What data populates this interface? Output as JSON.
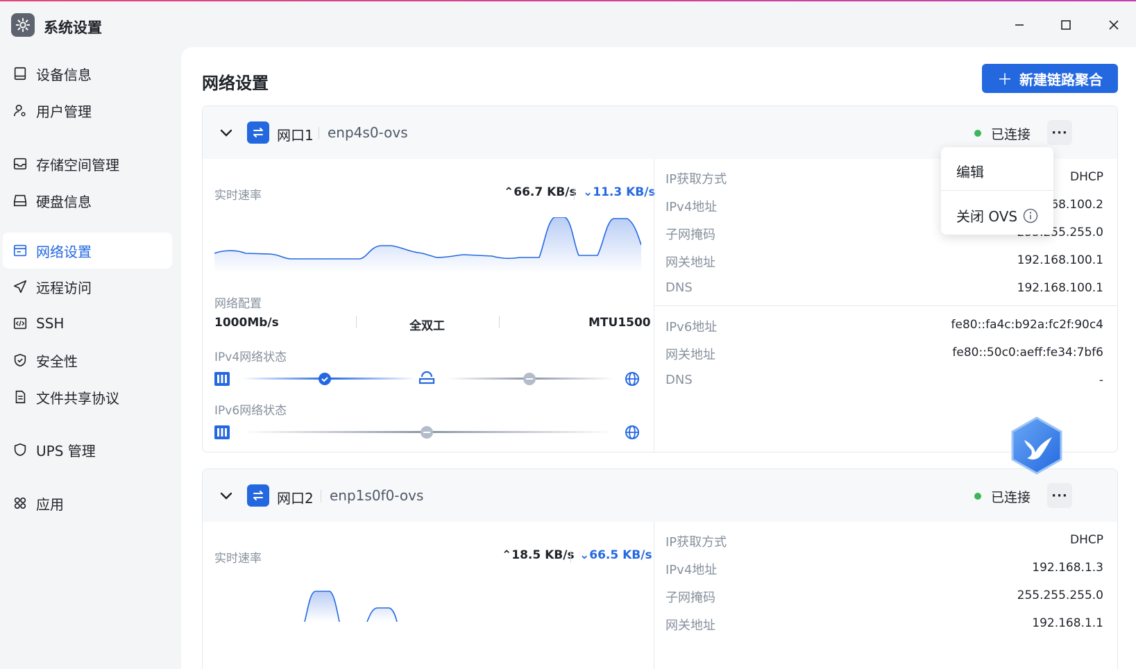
{
  "app": {
    "title": "系统设置"
  },
  "sidebar": {
    "items": [
      {
        "label": "设备信息",
        "icon": "monitor-icon"
      },
      {
        "label": "用户管理",
        "icon": "user-gear-icon"
      },
      {
        "label": "存储空间管理",
        "icon": "inbox-icon"
      },
      {
        "label": "硬盘信息",
        "icon": "disk-icon"
      },
      {
        "label": "网络设置",
        "icon": "network-window-icon",
        "active": true
      },
      {
        "label": "远程访问",
        "icon": "send-icon"
      },
      {
        "label": "SSH",
        "icon": "code-icon"
      },
      {
        "label": "安全性",
        "icon": "shield-check-icon"
      },
      {
        "label": "文件共享协议",
        "icon": "document-icon"
      },
      {
        "label": "UPS 管理",
        "icon": "shield-icon"
      },
      {
        "label": "应用",
        "icon": "apps-icon"
      }
    ]
  },
  "main": {
    "title": "网络设置",
    "new_button": "新建链路聚合",
    "cards": [
      {
        "port": "网口1",
        "device": "enp4s0-ovs",
        "status": "已连接",
        "more": "···",
        "realtime_label": "实时速率",
        "up": "66.7 KB/s",
        "down": "11.3 KB/s",
        "config_label": "网络配置",
        "speed": "1000Mb/s",
        "duplex": "全双工",
        "mtu": "MTU1500",
        "ipv4_state_label": "IPv4网络状态",
        "ipv6_state_label": "IPv6网络状态",
        "info": [
          {
            "k": "IP获取方式",
            "v": "DHCP"
          },
          {
            "k": "IPv4地址",
            "v": "192.168.100.2"
          },
          {
            "k": "子网掩码",
            "v": "255.255.255.0"
          },
          {
            "k": "网关地址",
            "v": "192.168.100.1"
          },
          {
            "k": "DNS",
            "v": "192.168.100.1"
          }
        ],
        "info6": [
          {
            "k": "IPv6地址",
            "v": "fe80::fa4c:b92a:fc2f:90c4"
          },
          {
            "k": "网关地址",
            "v": "fe80::50c0:aeff:fe34:7bf6"
          },
          {
            "k": "DNS",
            "v": "-"
          }
        ]
      },
      {
        "port": "网口2",
        "device": "enp1s0f0-ovs",
        "status": "已连接",
        "more": "···",
        "realtime_label": "实时速率",
        "up": "18.5 KB/s",
        "down": "66.5 KB/s",
        "info": [
          {
            "k": "IP获取方式",
            "v": "DHCP"
          },
          {
            "k": "IPv4地址",
            "v": "192.168.1.3"
          },
          {
            "k": "子网掩码",
            "v": "255.255.255.0"
          },
          {
            "k": "网关地址",
            "v": "192.168.1.1"
          }
        ]
      }
    ]
  },
  "popup": {
    "edit": "编辑",
    "close_ovs": "关闭 OVS"
  },
  "colors": {
    "accent": "#2468e0",
    "connected": "#3cb55b"
  }
}
